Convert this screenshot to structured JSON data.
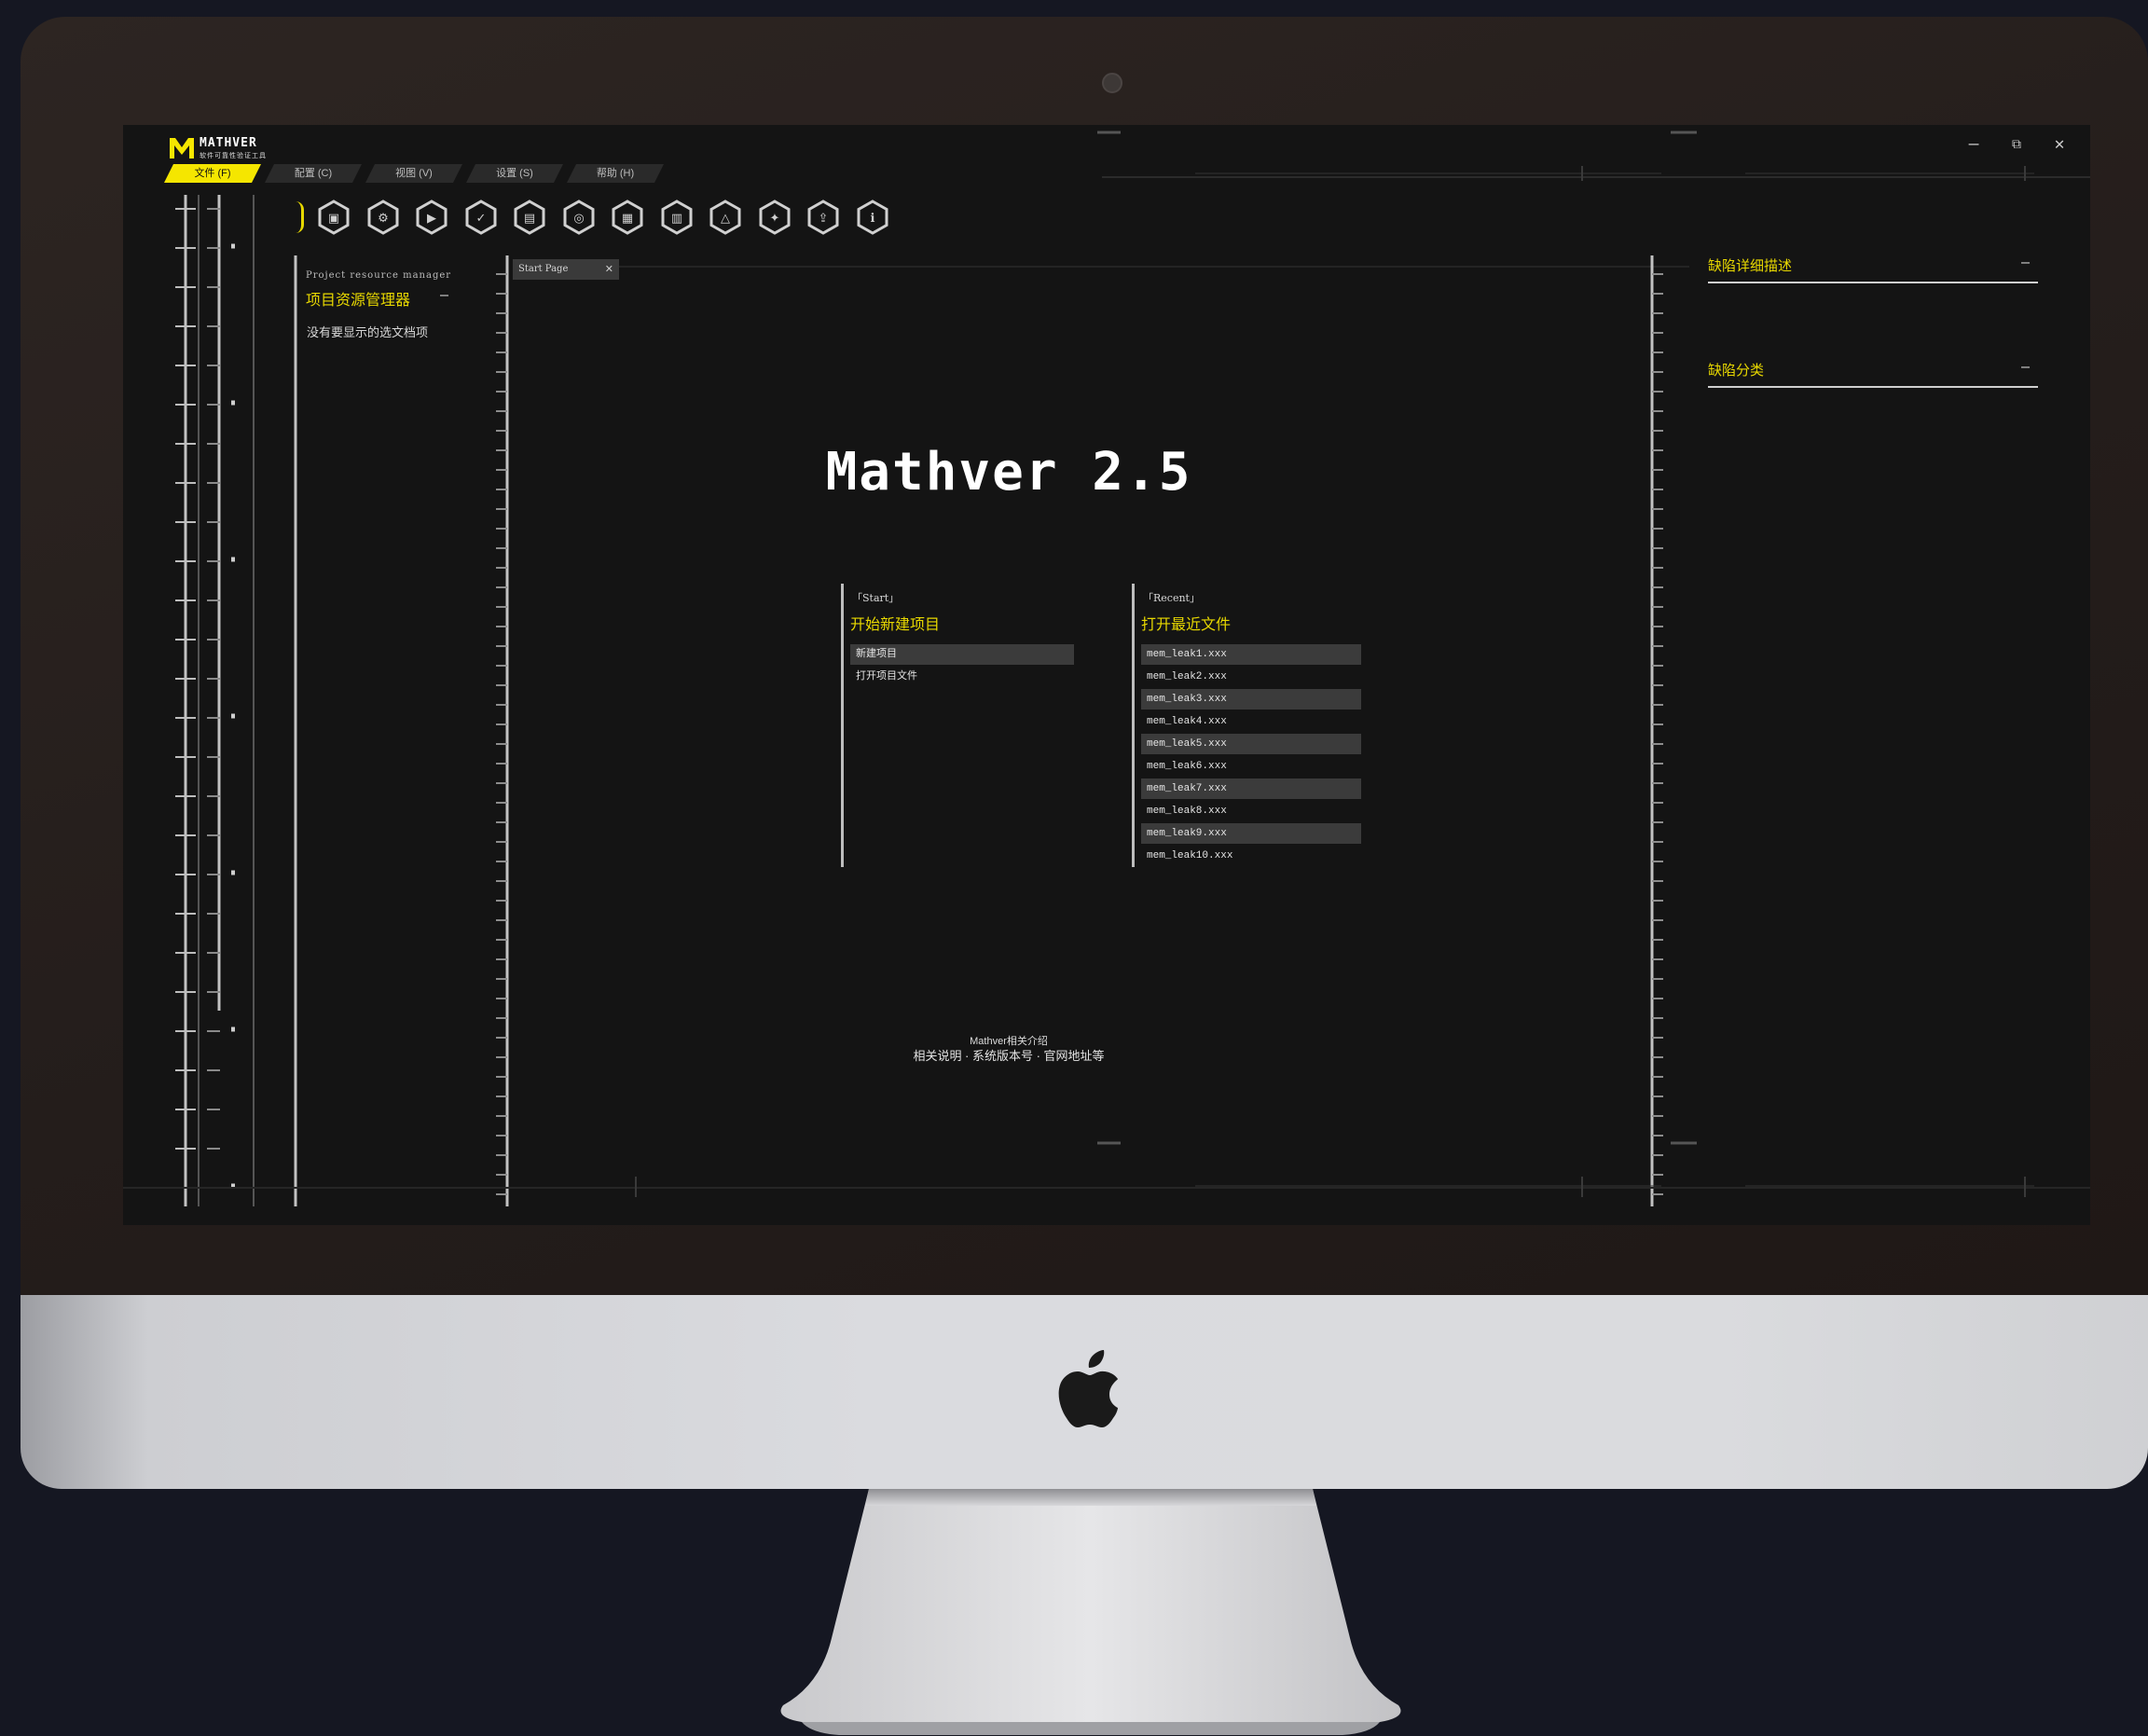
{
  "window": {
    "app_name": "MATHVER",
    "app_subtitle": "软件可靠性验证工具",
    "controls": {
      "minimize": "–",
      "maximize": "⧉",
      "close": "✕"
    }
  },
  "menu": [
    {
      "label": "文件 (F)",
      "active": true
    },
    {
      "label": "配置 (C)",
      "active": false
    },
    {
      "label": "视图 (V)",
      "active": false
    },
    {
      "label": "设置 (S)",
      "active": false
    },
    {
      "label": "帮助 (H)",
      "active": false
    }
  ],
  "toolbar": {
    "icons": [
      "new-icon",
      "settings-icon",
      "play-icon",
      "check-icon",
      "save-icon",
      "search-icon",
      "chart-icon",
      "document-icon",
      "warning-icon",
      "model-icon",
      "export-icon",
      "info-icon"
    ],
    "glyphs": [
      "▣",
      "⚙",
      "▶",
      "✓",
      "▤",
      "◎",
      "▦",
      "▥",
      "△",
      "✦",
      "⇪",
      "ℹ"
    ]
  },
  "project_panel": {
    "title_en": "Project resource manager",
    "title_cn": "项目资源管理器",
    "collapse": "–",
    "empty_message": "没有要显示的选文档项"
  },
  "doc_tab": {
    "label": "Start Page",
    "close": "✕"
  },
  "start_page": {
    "title": "Mathver 2.5",
    "start": {
      "tag": "「Start」",
      "heading": "开始新建项目",
      "items": [
        "新建项目",
        "打开项目文件"
      ]
    },
    "recent": {
      "tag": "「Recent」",
      "heading": "打开最近文件",
      "files": [
        "mem_leak1.xxx",
        "mem_leak2.xxx",
        "mem_leak3.xxx",
        "mem_leak4.xxx",
        "mem_leak5.xxx",
        "mem_leak6.xxx",
        "mem_leak7.xxx",
        "mem_leak8.xxx",
        "mem_leak9.xxx",
        "mem_leak10.xxx"
      ]
    },
    "about_title": "Mathver相关介绍",
    "about_links": "相关说明 · 系统版本号 · 官网地址等"
  },
  "right_panel": {
    "defect_description": "缺陷详细描述",
    "defect_category": "缺陷分类",
    "collapse": "–"
  },
  "colors": {
    "accent": "#f5e600",
    "screen_bg": "#141414",
    "device_bezel": "#2a2220",
    "device_chin": "#d9dadd",
    "page_bg": "#151722"
  }
}
